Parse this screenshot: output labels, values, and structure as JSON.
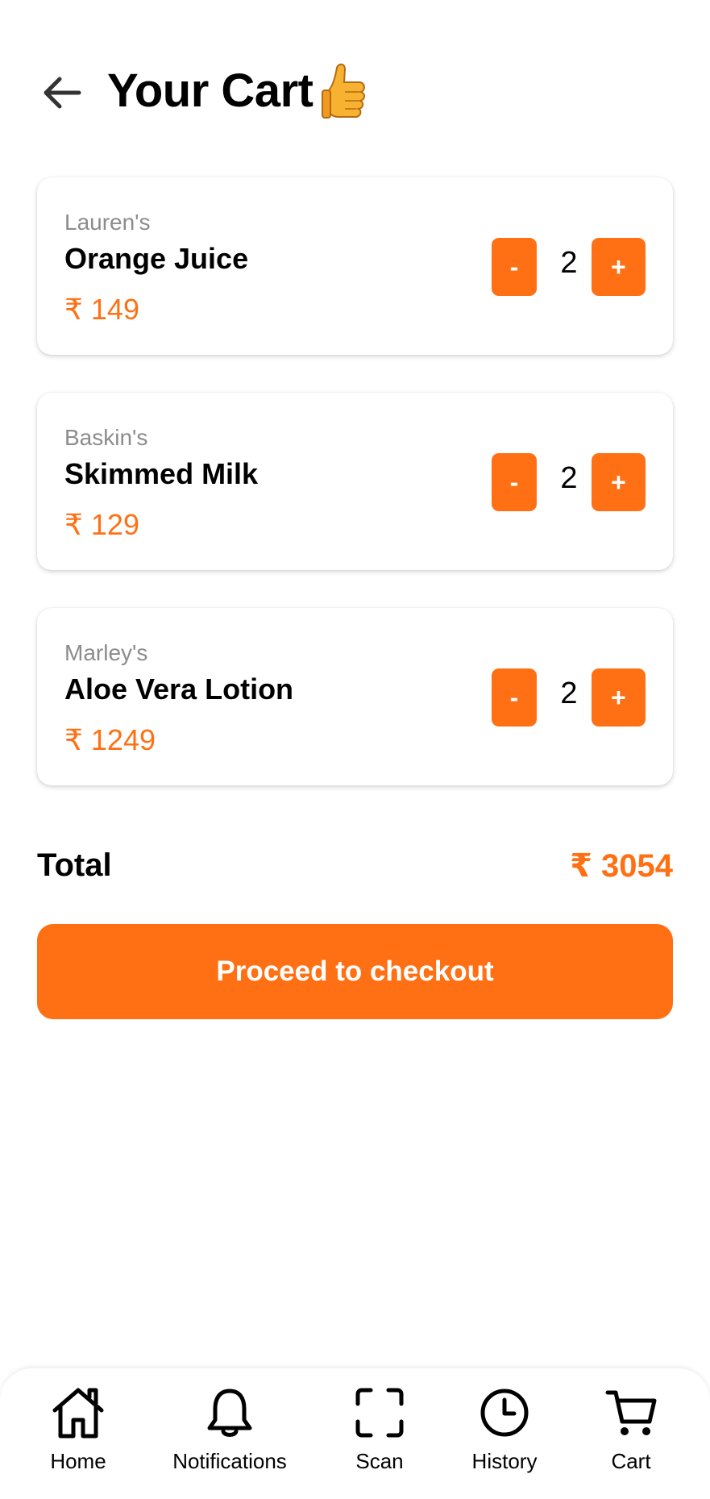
{
  "header": {
    "title": "Your Cart"
  },
  "currency_symbol": "₹",
  "cart": {
    "items": [
      {
        "brand": "Lauren's",
        "name": "Orange Juice",
        "price": "₹ 149",
        "quantity": "2"
      },
      {
        "brand": "Baskin's",
        "name": "Skimmed Milk",
        "price": "₹ 129",
        "quantity": "2"
      },
      {
        "brand": "Marley's",
        "name": "Aloe Vera Lotion",
        "price": "₹ 1249",
        "quantity": "2"
      }
    ],
    "decrement_label": "-",
    "increment_label": "+"
  },
  "total": {
    "label": "Total",
    "value": "₹ 3054"
  },
  "checkout": {
    "label": "Proceed to checkout"
  },
  "bottom_nav": {
    "items": [
      {
        "label": "Home",
        "icon": "home-icon"
      },
      {
        "label": "Notifications",
        "icon": "bell-icon"
      },
      {
        "label": "Scan",
        "icon": "scan-icon"
      },
      {
        "label": "History",
        "icon": "clock-icon"
      },
      {
        "label": "Cart",
        "icon": "cart-icon"
      }
    ]
  },
  "colors": {
    "accent": "#ff7014",
    "brand_text": "#8c8c8c"
  }
}
